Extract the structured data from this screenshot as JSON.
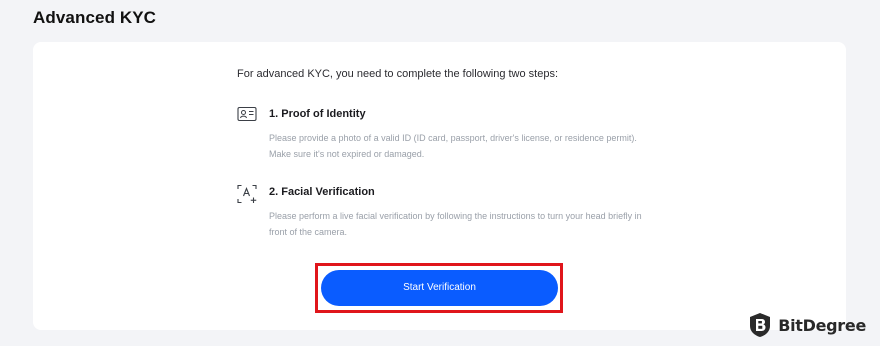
{
  "page": {
    "title": "Advanced KYC"
  },
  "card": {
    "intro": "For advanced KYC, you need to complete the following two steps:",
    "steps": [
      {
        "icon": "id-card-icon",
        "title": "1. Proof of Identity",
        "description": "Please provide a photo of a valid ID (ID card, passport, driver's license, or residence permit). Make sure it's not expired or damaged."
      },
      {
        "icon": "face-scan-icon",
        "title": "2. Facial Verification",
        "description": "Please perform a live facial verification by following the instructions to turn your head briefly in front of the camera."
      }
    ],
    "button_label": "Start Verification"
  },
  "watermark": {
    "text": "BitDegree"
  },
  "colors": {
    "background": "#f3f4f7",
    "card": "#ffffff",
    "accent_button": "#0a5cff",
    "highlight_border": "#e0151b",
    "muted_text": "#9aa0a9"
  }
}
